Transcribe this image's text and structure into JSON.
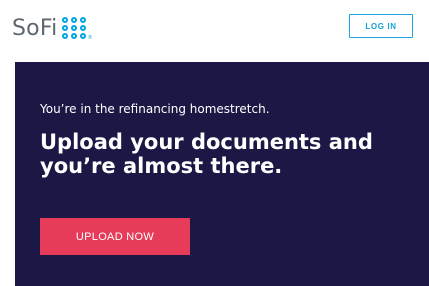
{
  "header": {
    "logo_text": "SoFi",
    "logo_mark_icon": "sofi-dots-logo",
    "logo_registered": "®",
    "login_label": "LOG IN"
  },
  "hero": {
    "eyebrow": "You’re in the refinancing homestretch.",
    "headline": "Upload your documents and you’re almost there.",
    "cta_label": "UPLOAD NOW"
  },
  "colors": {
    "brand_blue": "#00a4e4",
    "hero_bg": "#1c1846",
    "cta_bg": "#e63c5a",
    "logo_gray": "#5e6670"
  }
}
